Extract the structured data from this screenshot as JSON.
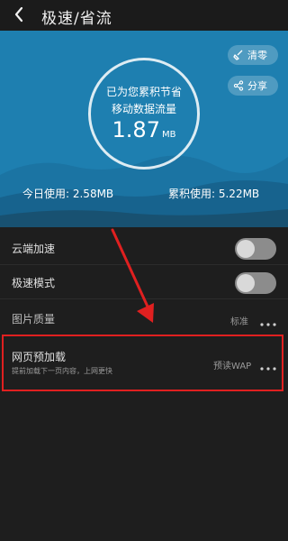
{
  "header": {
    "title": "极速/省流",
    "back_icon": "back-chevron-icon"
  },
  "hero": {
    "background_color": "#1e7fb0",
    "saved_line1": "已为您累积节省",
    "saved_line2": "移动数据流量",
    "saved_value": "1.87",
    "saved_unit": "MB",
    "clear_label": "清零",
    "clear_icon": "broom-icon",
    "share_label": "分享",
    "share_icon": "share-icon",
    "today_usage": "今日使用: 2.58MB",
    "total_usage": "累积使用: 5.22MB"
  },
  "settings": {
    "cloud_accel": {
      "label": "云端加速",
      "enabled": false
    },
    "fast_mode": {
      "label": "极速模式",
      "enabled": false
    },
    "image_quality": {
      "label": "图片质量",
      "value": "标准"
    },
    "page_preload": {
      "label": "网页预加载",
      "description": "提前加载下一页内容，上网更快",
      "value": "预读WAP"
    }
  },
  "annotation": {
    "color": "#e02020"
  }
}
